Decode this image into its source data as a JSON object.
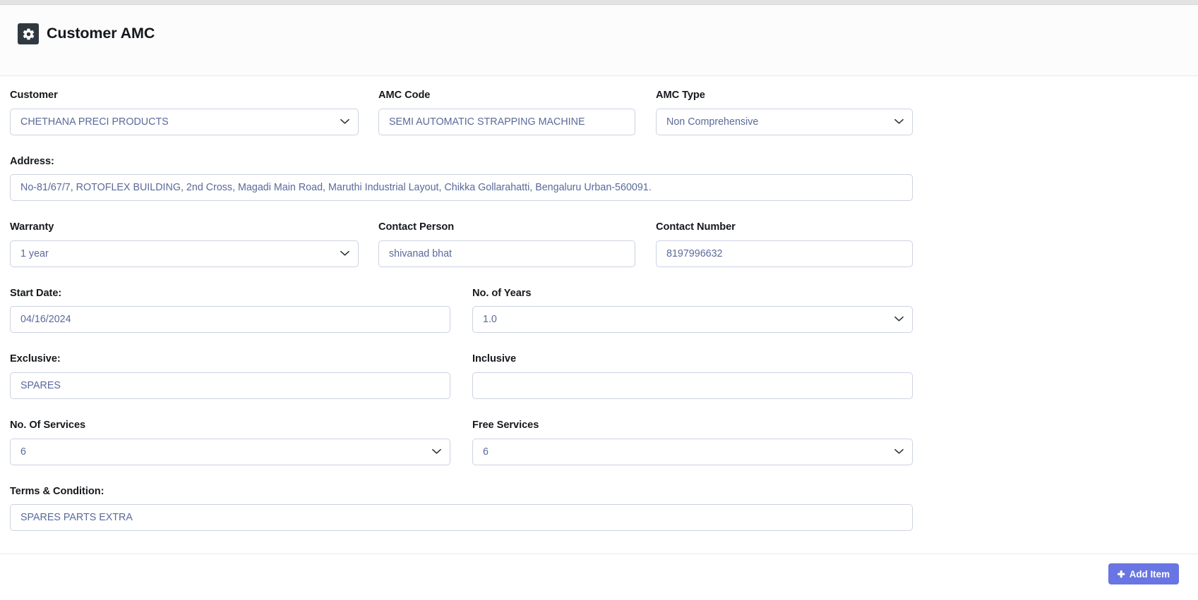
{
  "header": {
    "title": "Customer AMC",
    "icon": "gear-icon"
  },
  "form": {
    "customer": {
      "label": "Customer",
      "value": "CHETHANA PRECI PRODUCTS",
      "type": "select"
    },
    "amc_code": {
      "label": "AMC Code",
      "value": "SEMI AUTOMATIC STRAPPING MACHINE",
      "type": "text"
    },
    "amc_type": {
      "label": "AMC Type",
      "value": "Non Comprehensive",
      "type": "select"
    },
    "address": {
      "label": "Address:",
      "value": "No-81/67/7, ROTOFLEX BUILDING, 2nd Cross, Magadi Main Road, Maruthi Industrial Layout, Chikka Gollarahatti, Bengaluru Urban-560091.",
      "type": "text"
    },
    "warranty": {
      "label": "Warranty",
      "value": "1 year",
      "type": "select"
    },
    "contact_person": {
      "label": "Contact Person",
      "value": "shivanad bhat",
      "type": "text"
    },
    "contact_number": {
      "label": "Contact Number",
      "value": "8197996632",
      "type": "text"
    },
    "start_date": {
      "label": "Start Date:",
      "value": "04/16/2024",
      "type": "date"
    },
    "no_of_years": {
      "label": "No. of Years",
      "value": "1.0",
      "type": "select"
    },
    "exclusive": {
      "label": "Exclusive:",
      "value": "SPARES",
      "type": "text"
    },
    "inclusive": {
      "label": "Inclusive",
      "value": "",
      "type": "text"
    },
    "no_of_services": {
      "label": "No. Of Services",
      "value": "6",
      "type": "select"
    },
    "free_services": {
      "label": "Free Services",
      "value": "6",
      "type": "select"
    },
    "terms": {
      "label": "Terms & Condition:",
      "value": "SPARES PARTS EXTRA",
      "type": "text"
    }
  },
  "footer": {
    "add_item_label": "Add Item",
    "add_item_icon": "plus-icon"
  },
  "colors": {
    "accent": "#6875e2",
    "header_icon_bg": "#303841",
    "field_border": "#ccd2e3",
    "field_text": "#5a6a9a",
    "label_text": "#16191d"
  }
}
